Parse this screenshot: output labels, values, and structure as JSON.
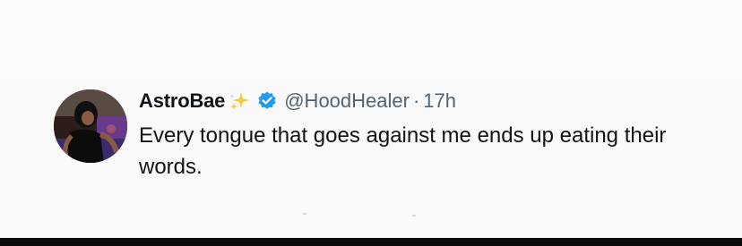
{
  "tweet": {
    "display_name": "AstroBae",
    "handle": "@HoodHealer",
    "separator": "·",
    "time": "17h",
    "text": "Every tongue that goes against me ends up eating their words."
  },
  "icons": {
    "name_emoji": "sparkle-icon",
    "verified": "verified-badge-icon",
    "verified_color": "#1d9bf0",
    "sparkle_color": "#f7c948"
  }
}
